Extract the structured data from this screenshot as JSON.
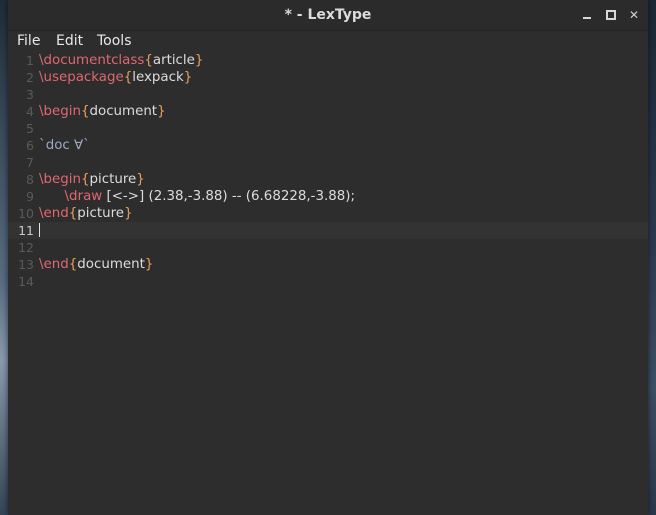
{
  "window": {
    "title": "* - LexType"
  },
  "menu": {
    "file": "File",
    "edit": "Edit",
    "tools": "Tools"
  },
  "editor": {
    "current_line": 11,
    "lines": [
      {
        "num": "1",
        "tokens": [
          {
            "t": "\\documentclass",
            "c": "kw"
          },
          {
            "t": "{",
            "c": "br"
          },
          {
            "t": "article",
            "c": "tx"
          },
          {
            "t": "}",
            "c": "br"
          }
        ]
      },
      {
        "num": "2",
        "tokens": [
          {
            "t": "\\usepackage",
            "c": "kw"
          },
          {
            "t": "{",
            "c": "br"
          },
          {
            "t": "lexpack",
            "c": "tx"
          },
          {
            "t": "}",
            "c": "br"
          }
        ]
      },
      {
        "num": "3",
        "tokens": []
      },
      {
        "num": "4",
        "tokens": [
          {
            "t": "\\begin",
            "c": "kw"
          },
          {
            "t": "{",
            "c": "br"
          },
          {
            "t": "document",
            "c": "tx"
          },
          {
            "t": "}",
            "c": "br"
          }
        ]
      },
      {
        "num": "5",
        "tokens": []
      },
      {
        "num": "6",
        "tokens": [
          {
            "t": "`doc ∀`",
            "c": "bq"
          }
        ]
      },
      {
        "num": "7",
        "tokens": []
      },
      {
        "num": "8",
        "tokens": [
          {
            "t": "\\begin",
            "c": "kw"
          },
          {
            "t": "{",
            "c": "br"
          },
          {
            "t": "picture",
            "c": "tx"
          },
          {
            "t": "}",
            "c": "br"
          }
        ]
      },
      {
        "num": "9",
        "tokens": [
          {
            "t": "      ",
            "c": "tx"
          },
          {
            "t": "\\draw",
            "c": "kw"
          },
          {
            "t": " [<->] (2.38,-3.88) -- (6.68228,-3.88);",
            "c": "tx"
          }
        ]
      },
      {
        "num": "10",
        "tokens": [
          {
            "t": "\\end",
            "c": "kw"
          },
          {
            "t": "{",
            "c": "br"
          },
          {
            "t": "picture",
            "c": "tx"
          },
          {
            "t": "}",
            "c": "br"
          }
        ]
      },
      {
        "num": "11",
        "tokens": []
      },
      {
        "num": "12",
        "tokens": []
      },
      {
        "num": "13",
        "tokens": [
          {
            "t": "\\end",
            "c": "kw"
          },
          {
            "t": "{",
            "c": "br"
          },
          {
            "t": "document",
            "c": "tx"
          },
          {
            "t": "}",
            "c": "br"
          }
        ]
      },
      {
        "num": "14",
        "tokens": []
      }
    ]
  }
}
